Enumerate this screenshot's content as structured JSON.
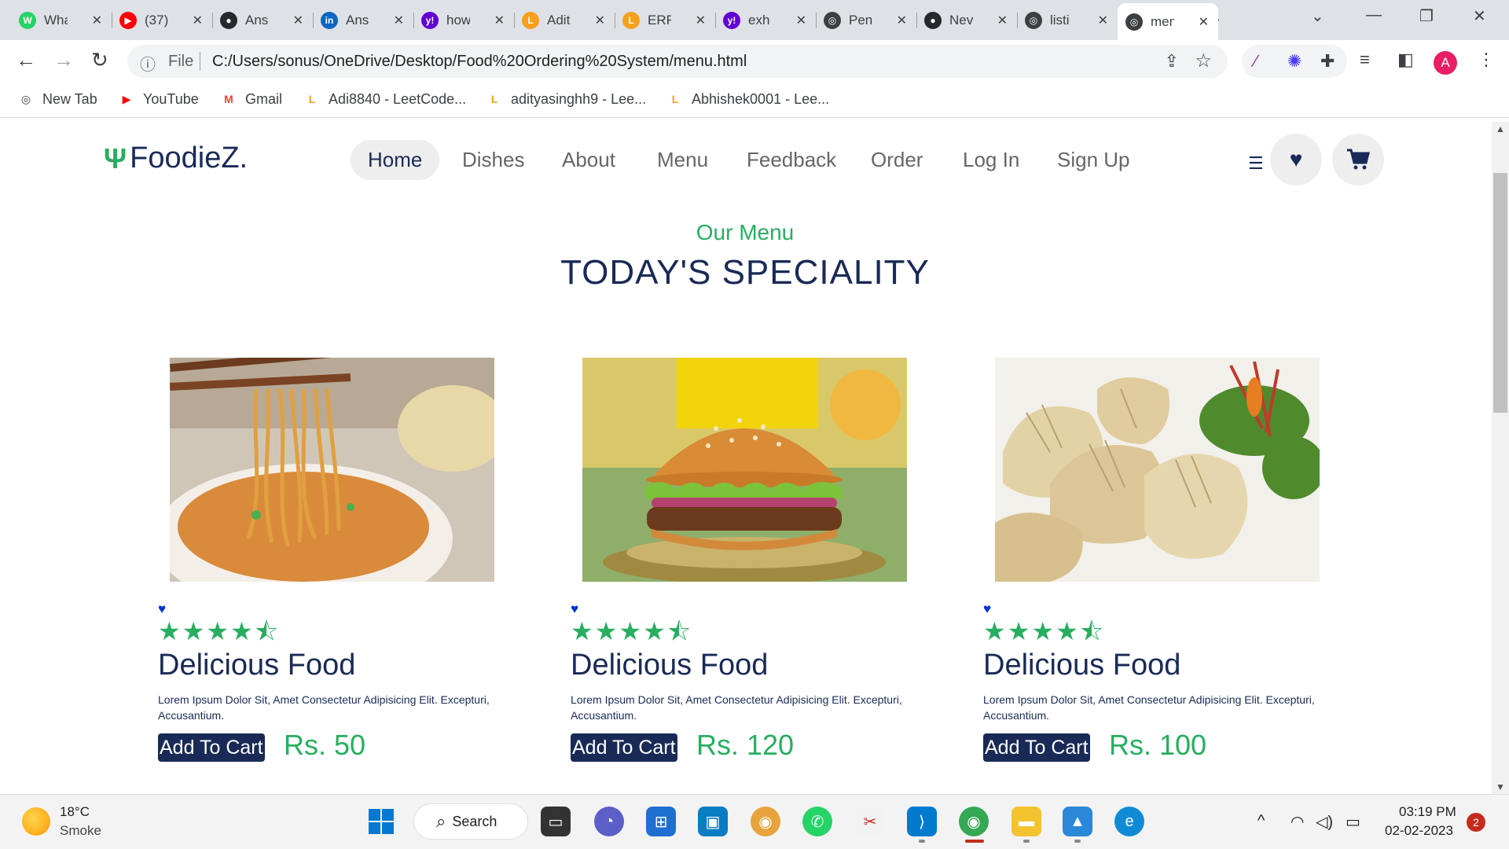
{
  "browser": {
    "tabs": [
      {
        "title": "WhatsApp",
        "icon": "whatsapp-icon",
        "color": "#25d366",
        "glyph": "W"
      },
      {
        "title": "(37)",
        "icon": "youtube-icon",
        "color": "#ff0000",
        "glyph": "▶"
      },
      {
        "title": "Ans",
        "icon": "github-icon",
        "color": "#24292e",
        "glyph": "●"
      },
      {
        "title": "Ans",
        "icon": "linkedin-icon",
        "color": "#0a66c2",
        "glyph": "in"
      },
      {
        "title": "how",
        "icon": "yahoo-icon",
        "color": "#6001d2",
        "glyph": "y!"
      },
      {
        "title": "Adit",
        "icon": "leetcode-icon",
        "color": "#f89f1b",
        "glyph": "L"
      },
      {
        "title": "ERR",
        "icon": "leetcode-icon",
        "color": "#f89f1b",
        "glyph": "L"
      },
      {
        "title": "exh",
        "icon": "yahoo-icon",
        "color": "#6001d2",
        "glyph": "y!"
      },
      {
        "title": "Pen",
        "icon": "globe-icon",
        "color": "#3c4043",
        "glyph": "◎"
      },
      {
        "title": "Nev",
        "icon": "github-icon",
        "color": "#24292e",
        "glyph": "●"
      },
      {
        "title": "listi",
        "icon": "globe-icon",
        "color": "#3c4043",
        "glyph": "◎"
      },
      {
        "title": "menu",
        "icon": "globe-icon",
        "color": "#3c4043",
        "glyph": "◎"
      }
    ],
    "close_glyph": "✕",
    "newtab_glyph": "+",
    "url_scheme_label": "File",
    "url": "C:/Users/sonus/OneDrive/Desktop/Food%20Ordering%20System/menu.html",
    "profile_initial": "A",
    "bookmarks": [
      {
        "label": "New Tab",
        "icon": "globe-icon",
        "glyph": "◎",
        "color": "#3c4043"
      },
      {
        "label": "YouTube",
        "icon": "youtube-icon",
        "glyph": "▶",
        "color": "#ff0000"
      },
      {
        "label": "Gmail",
        "icon": "gmail-icon",
        "glyph": "M",
        "color": "#ea4335"
      },
      {
        "label": "Adi8840 - LeetCode...",
        "icon": "leetcode-icon",
        "glyph": "L",
        "color": "#f89f1b"
      },
      {
        "label": "adityasinghh9 - Lee...",
        "icon": "leetcode-icon",
        "glyph": "L",
        "color": "#f89f1b"
      },
      {
        "label": "Abhishek0001 - Lee...",
        "icon": "leetcode-icon",
        "glyph": "L",
        "color": "#f89f1b"
      }
    ]
  },
  "site": {
    "logo": "FoodieZ.",
    "nav": [
      "Home",
      "Dishes",
      "About",
      "Menu",
      "Feedback",
      "Order",
      "Log In",
      "Sign Up"
    ],
    "section_subtitle": "Our Menu",
    "section_title": "TODAY'S SPECIALITY",
    "cards": [
      {
        "title": "Delicious Food",
        "desc": "Lorem Ipsum Dolor Sit, Amet Consectetur Adipisicing Elit. Excepturi, Accusantium.",
        "button": "Add To Cart",
        "price": "Rs. 50",
        "rating": 4.5,
        "image": "noodles-image"
      },
      {
        "title": "Delicious Food",
        "desc": "Lorem Ipsum Dolor Sit, Amet Consectetur Adipisicing Elit. Excepturi, Accusantium.",
        "button": "Add To Cart",
        "price": "Rs. 120",
        "rating": 4.5,
        "image": "burger-image"
      },
      {
        "title": "Delicious Food",
        "desc": "Lorem Ipsum Dolor Sit, Amet Consectetur Adipisicing Elit. Excepturi, Accusantium.",
        "button": "Add To Cart",
        "price": "Rs. 100",
        "rating": 4.5,
        "image": "momos-image"
      }
    ],
    "colors": {
      "primary": "#192a56",
      "accent": "#27ae60"
    }
  },
  "taskbar": {
    "weather_temp": "18°C",
    "weather_cond": "Smoke",
    "search_label": "Search",
    "time": "03:19 PM",
    "date": "02-02-2023",
    "notifications": "2"
  }
}
